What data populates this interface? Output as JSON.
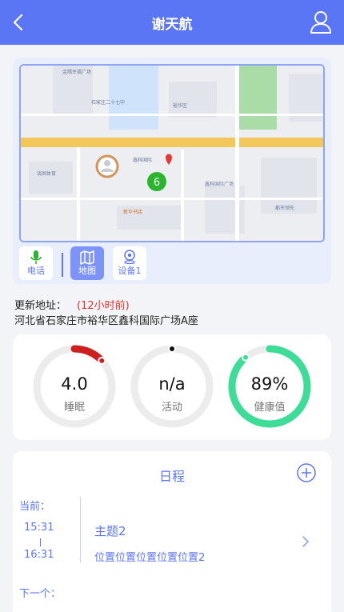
{
  "header": {
    "title": "谢天航"
  },
  "map": {
    "cluster_count": "6",
    "pois": [
      "金隅幸福广场",
      "石家庄二十七中",
      "裕华区",
      "鑫科国际",
      "谈固体育",
      "鑫科国际广场",
      "新华书店",
      "都市领先"
    ],
    "tabs": [
      {
        "label": "电话",
        "icon": "microphone-icon"
      },
      {
        "label": "地图",
        "icon": "map-icon"
      },
      {
        "label": "设备1",
        "icon": "location-pin-icon"
      }
    ]
  },
  "address": {
    "label": "更新地址：",
    "time": "(12小时前)",
    "text": "河北省石家庄市裕华区鑫科国际广场A座"
  },
  "stats": [
    {
      "value": "4.0",
      "label": "睡眠",
      "color": "#cc1f1f",
      "fraction": 0.13
    },
    {
      "value": "n/a",
      "label": "活动",
      "color": "#111111",
      "fraction": 0
    },
    {
      "value": "89%",
      "label": "健康值",
      "color": "#3ddc97",
      "fraction": 0.89
    }
  ],
  "schedule": {
    "title": "日程",
    "current_label": "当前：",
    "next_label": "下一个：",
    "current": {
      "start": "15:31",
      "end": "16:31",
      "title": "主题2",
      "location": "位置位置位置位置位置2"
    }
  }
}
